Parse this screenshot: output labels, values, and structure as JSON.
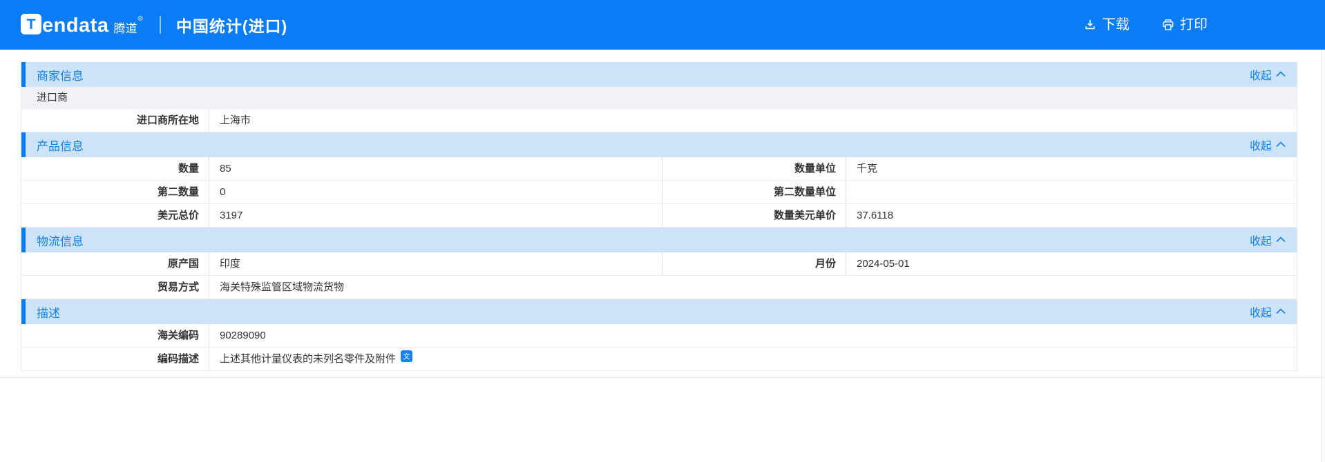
{
  "header": {
    "logo": {
      "icon_letter": "T",
      "brand_rest": "endata",
      "brand_cn": "腾道",
      "reg": "®"
    },
    "title": "中国统计(进口)",
    "actions": {
      "download": "下载",
      "print": "打印"
    }
  },
  "icons": {
    "download": "download-icon",
    "print": "printer-icon",
    "collapse": "chevron-up-icon",
    "translate": "translate-icon"
  },
  "colors": {
    "header_bg": "#0a7cf5",
    "section_bg": "#cde3f8",
    "accent_blue": "#0f80f2",
    "subrow_bg": "#f1f3f6"
  },
  "collapse_label": "收起",
  "sections": [
    {
      "title": "商家信息",
      "subheader": "进口商",
      "rows": [
        {
          "label": "进口商所在地",
          "value": "上海市"
        }
      ]
    },
    {
      "title": "产品信息",
      "rows": [
        {
          "left": {
            "label": "数量",
            "value": "85"
          },
          "right": {
            "label": "数量单位",
            "value": "千克"
          }
        },
        {
          "left": {
            "label": "第二数量",
            "value": "0"
          },
          "right": {
            "label": "第二数量单位",
            "value": ""
          }
        },
        {
          "left": {
            "label": "美元总价",
            "value": "3197"
          },
          "right": {
            "label": "数量美元单价",
            "value": "37.6118"
          }
        }
      ]
    },
    {
      "title": "物流信息",
      "rows": [
        {
          "left": {
            "label": "原产国",
            "value": "印度"
          },
          "right": {
            "label": "月份",
            "value": "2024-05-01"
          }
        },
        {
          "label": "贸易方式",
          "value": "海关特殊监管区域物流货物"
        }
      ]
    },
    {
      "title": "描述",
      "rows": [
        {
          "label": "海关编码",
          "value": "90289090"
        },
        {
          "label": "编码描述",
          "value": "上述其他计量仪表的未列名零件及附件"
        }
      ]
    }
  ]
}
